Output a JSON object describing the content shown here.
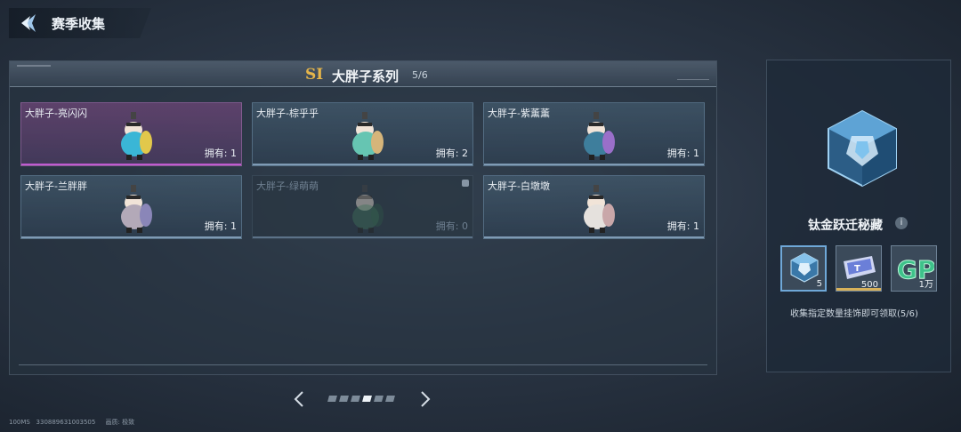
{
  "header": {
    "title": "赛季收集"
  },
  "series": {
    "badge": "SI",
    "title": "大胖子系列",
    "count": "5/6"
  },
  "cards": [
    {
      "name": "大胖子-亮闪闪",
      "owned": "拥有: 1",
      "body": "#3ab6d6",
      "accent": "#e2c84b",
      "rarity": "purple",
      "locked": false
    },
    {
      "name": "大胖子-棕乎乎",
      "owned": "拥有: 2",
      "body": "#66c5b2",
      "accent": "#d6b57a",
      "rarity": "blue",
      "locked": false
    },
    {
      "name": "大胖子-紫薰薰",
      "owned": "拥有: 1",
      "body": "#3e7e9c",
      "accent": "#9a6fc9",
      "rarity": "blue",
      "locked": false
    },
    {
      "name": "大胖子-兰胖胖",
      "owned": "拥有: 1",
      "body": "#b3a9b8",
      "accent": "#8a86b8",
      "rarity": "blue",
      "locked": false
    },
    {
      "name": "大胖子-绿萌萌",
      "owned": "拥有: 0",
      "body": "#3f6e58",
      "accent": "#2e5546",
      "rarity": "blue",
      "locked": true
    },
    {
      "name": "大胖子-白墩墩",
      "owned": "拥有: 1",
      "body": "#e5e1dd",
      "accent": "#c9a7a9",
      "rarity": "blue",
      "locked": false
    }
  ],
  "pager": {
    "pages": 6,
    "current": 4
  },
  "reward": {
    "title": "钛金跃迁秘藏",
    "info_icon": "i",
    "items": [
      {
        "icon": "crystal-cube-icon",
        "qty": "5"
      },
      {
        "icon": "ticket-icon",
        "qty": "500"
      },
      {
        "icon": "gp-coin-icon",
        "qty": "1万"
      }
    ],
    "description": "收集指定数量挂饰即可领取(5/6)"
  },
  "footer": {
    "ping": "100MS",
    "uid": "330889631003505",
    "extra": "画质: 极致"
  }
}
